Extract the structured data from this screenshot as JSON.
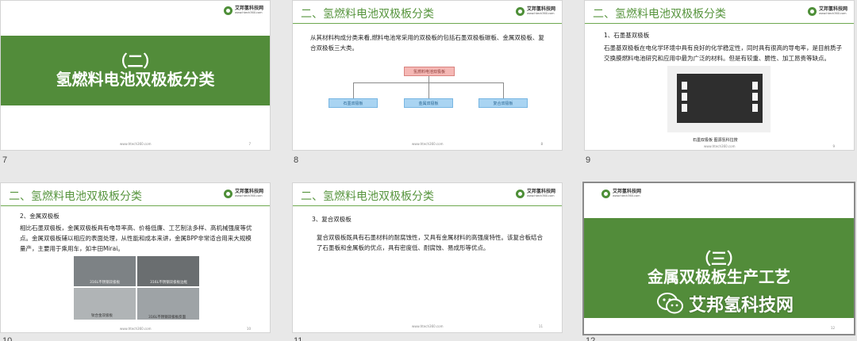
{
  "logo": {
    "name": "艾邦氢科技网",
    "url": "www.htech360.com"
  },
  "footer_url": "www.htech360.com",
  "section_title": "二、氢燃料电池双极板分类",
  "slides": [
    {
      "number": "7",
      "band_l1": "（二）",
      "band_l2": "氢燃料电池双极板分类",
      "page": "7"
    },
    {
      "number": "8",
      "text": "从其材料构成分类来看,燃料电池常采用的双极板的包括石墨双极板碳板、金属双极板、复合双极板三大类。",
      "chart_root": "氢燃料电池双极板",
      "chart_children": [
        "石墨双极板",
        "金属双极板",
        "复合双极板"
      ],
      "page": "8"
    },
    {
      "number": "9",
      "heading": "1、石墨基双极板",
      "text": "石墨基双极板在电化学环境中具有良好的化学稳定性，同时具有很高的导电率，是目前质子交换膜燃料电池研究和应用中最为广泛的材料。但是有较重、脆性、加工昂贵等缺点。",
      "caption": "石墨双极板 图源氢科拉搜",
      "page": "9"
    },
    {
      "number": "10",
      "heading": "2、金属双极板",
      "text": "相比石墨双极板，金属双极板具有电导率高、价格低廉、工艺制法多样、高机械强度等优点。金属双极板辅以相应的表面处理，从性能和成本来讲，金属BPP非常适合用来大规模量产，主要用于乘用车，如丰田Mirai。",
      "photo_caps": [
        "316L不锈钢双极板",
        "316L不锈钢双极板边框",
        "钛合金双极板",
        "316L不锈钢双极板反面"
      ],
      "page": "10"
    },
    {
      "number": "11",
      "heading": "3、复合双极板",
      "text": "复合双极板既具有石墨材料的耐腐蚀性，又具有金属材料的高强度特性。该复合板结合了石墨板和金属板的优点，具有密度低、耐腐蚀、易成形等优点。",
      "page": "11"
    },
    {
      "number": "12",
      "band_l1": "（三）",
      "band_l2": "金属双极板生产工艺",
      "watermark": "艾邦氢科技网",
      "page": "12"
    }
  ],
  "colors": {
    "brand_green": "#528c3a",
    "title_green": "#57953e"
  }
}
